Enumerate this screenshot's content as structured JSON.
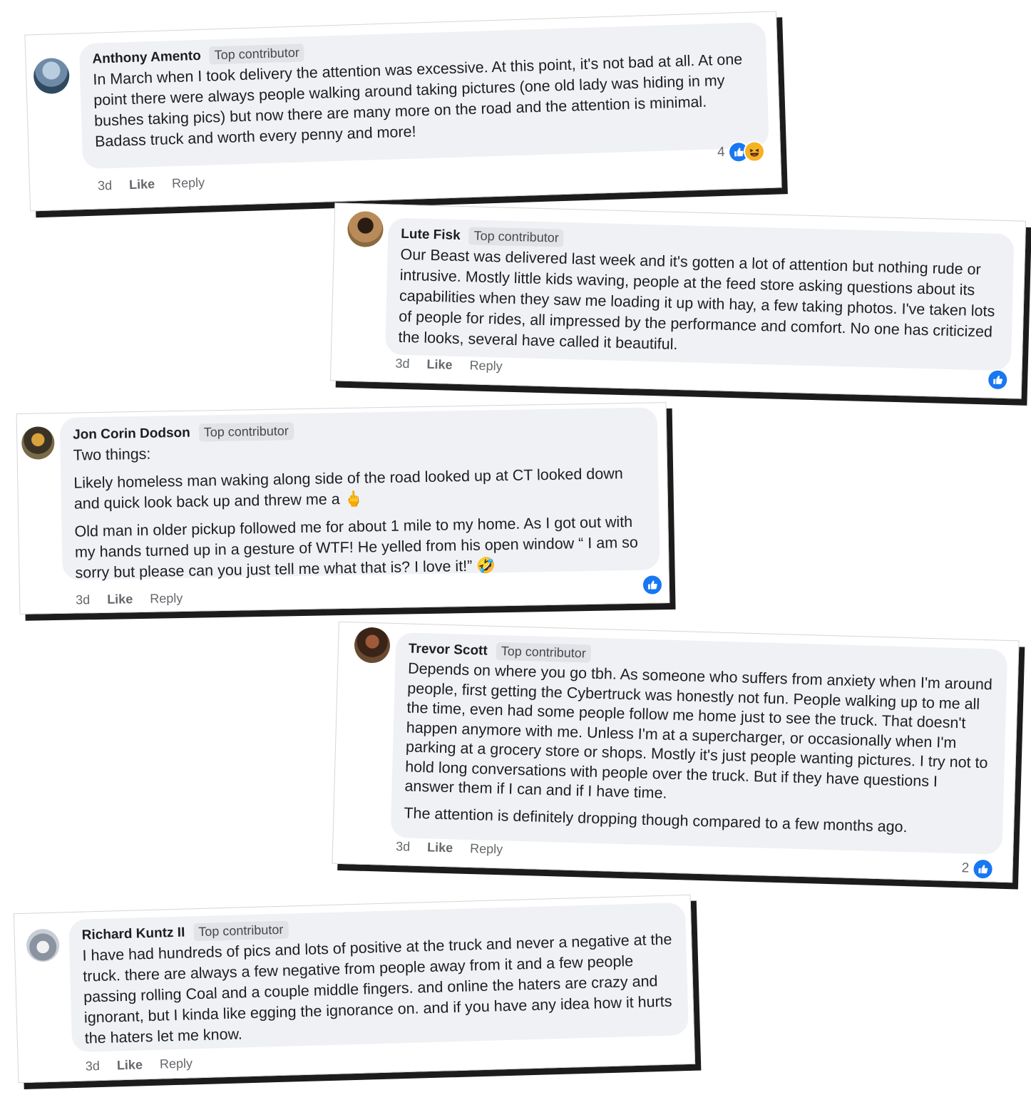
{
  "colors": {
    "like_blue": "#1877f2",
    "bubble_gray": "#eff1f4",
    "badge_gray": "#e1e3e7",
    "meta_text": "#65676b",
    "shadow": "#1c1c1c"
  },
  "comments": [
    {
      "author": "Anthony Amento",
      "badge": "Top contributor",
      "paragraphs": [
        "In March when I took delivery the attention was excessive. At this point, it's not bad at all. At one point there were always people walking around taking pictures (one old lady was hiding in my bushes taking pics) but now there are many more on the road and the attention is minimal. Badass truck and worth every penny and more!"
      ],
      "time": "3d",
      "like_label": "Like",
      "reply_label": "Reply",
      "reaction_count": "4",
      "reactions": [
        "like-icon",
        "haha-icon"
      ]
    },
    {
      "author": "Lute Fisk",
      "badge": "Top contributor",
      "paragraphs": [
        "Our Beast was delivered last week and it's gotten a lot of attention but nothing rude or intrusive. Mostly little kids waving, people at the feed store asking questions about its capabilities when they saw me loading it up with hay, a few taking photos. I've taken lots of people for rides, all impressed by the performance and comfort. No one has criticized the looks, several have called it beautiful."
      ],
      "time": "3d",
      "like_label": "Like",
      "reply_label": "Reply",
      "reaction_count": "",
      "reactions": [
        "like-icon"
      ]
    },
    {
      "author": "Jon Corin Dodson",
      "badge": "Top contributor",
      "paragraphs": [
        "Two things:",
        "Likely homeless man waking along side of the road looked up at CT looked down and quick look back up and threw me a 🖕",
        "Old man in older pickup followed me for about 1 mile to my home. As I got out with my hands turned up in a gesture of WTF! He yelled from his open window “ I am so sorry but please can you just tell me what that is? I love it!” 🤣"
      ],
      "time": "3d",
      "like_label": "Like",
      "reply_label": "Reply",
      "reaction_count": "",
      "reactions": [
        "like-icon"
      ]
    },
    {
      "author": "Trevor Scott",
      "badge": "Top contributor",
      "paragraphs": [
        "Depends on where you go tbh. As someone who suffers from anxiety when I'm around people, first getting the Cybertruck was honestly not fun. People walking up to me all the time, even had some people follow me home just to see the truck. That doesn't happen anymore with me. Unless I'm at a supercharger, or occasionally when I'm parking at a grocery store or shops. Mostly it's just people wanting pictures. I try not to hold long conversations with people over the truck. But if they have questions I answer them if I can and if I have time.",
        "The attention is definitely dropping though compared to a few months ago."
      ],
      "time": "3d",
      "like_label": "Like",
      "reply_label": "Reply",
      "reaction_count": "2",
      "reactions": [
        "like-icon"
      ]
    },
    {
      "author": "Richard Kuntz II",
      "badge": "Top contributor",
      "paragraphs": [
        "I have had hundreds of pics and lots of positive at the truck and never a negative at the truck. there are always a few negative from people away from it and a few people passing rolling Coal and a couple middle fingers. and online the haters are crazy and ignorant, but I kinda like egging the ignorance on. and if you have any idea how it hurts the haters let me know."
      ],
      "time": "3d",
      "like_label": "Like",
      "reply_label": "Reply",
      "reaction_count": "",
      "reactions": []
    }
  ]
}
